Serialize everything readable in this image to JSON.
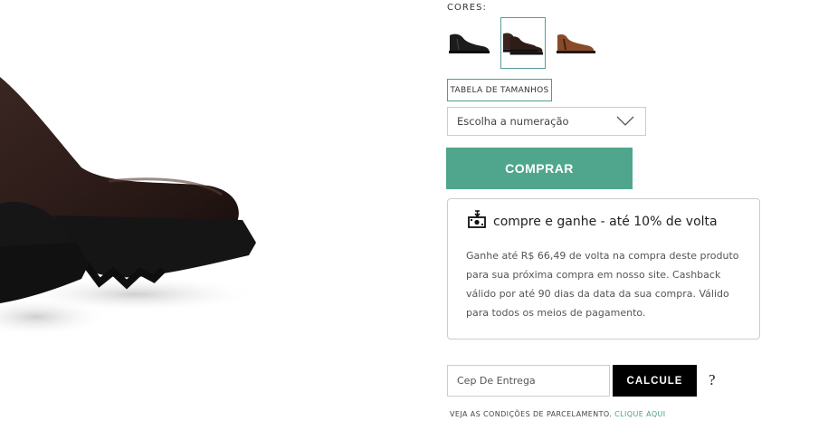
{
  "product": {
    "image_icon": "chelsea-boot-product-image"
  },
  "colors": {
    "label": "CORES:",
    "swatches": [
      {
        "icon": "black-boot-thumbnail",
        "color": "#1c1c1c",
        "selected": false
      },
      {
        "icon": "dark-brown-boot-thumbnail",
        "color": "#3b2420",
        "selected": true
      },
      {
        "icon": "tan-boot-thumbnail",
        "color": "#8a4a2a",
        "selected": false
      }
    ]
  },
  "size": {
    "table_label": "TABELA DE TAMANHOS",
    "select_placeholder": "Escolha a numeração"
  },
  "buy": {
    "label": "COMPRAR",
    "color": "#50a68c"
  },
  "cashback": {
    "icon": "cashback-icon",
    "title": "compre e ganhe - até 10% de volta",
    "description": "Ganhe até R$ 66,49 de volta na compra deste produto para sua próxima compra em nosso site. Cashback válido por até 90 dias da data da sua compra. Válido para todos os meios de pagamento."
  },
  "shipping": {
    "cep_placeholder": "Cep De Entrega",
    "calc_label": "CALCULE",
    "help_label": "?"
  },
  "installments": {
    "note": "VEJA AS CONDIÇÕES DE PARCELAMENTO.",
    "link": "CLIQUE AQUI",
    "link_color": "#4aa08a"
  }
}
